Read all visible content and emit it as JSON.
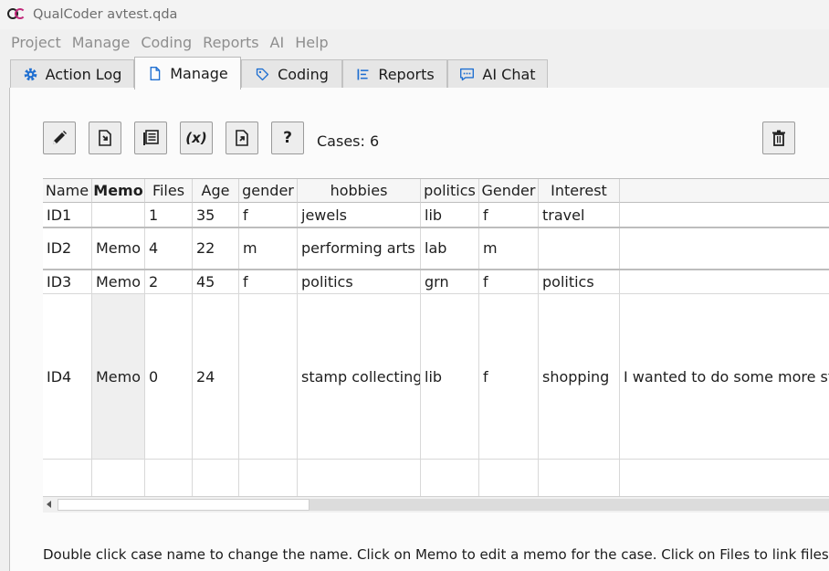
{
  "window": {
    "title": "QualCoder avtest.qda"
  },
  "menu": [
    "Project",
    "Manage",
    "Coding",
    "Reports",
    "AI",
    "Help"
  ],
  "tabs": [
    {
      "label": "Action Log",
      "icon": "gear-icon"
    },
    {
      "label": "Manage",
      "icon": "document-icon",
      "active": true
    },
    {
      "label": "Coding",
      "icon": "tag-icon"
    },
    {
      "label": "Reports",
      "icon": "list-icon"
    },
    {
      "label": "AI Chat",
      "icon": "chat-icon"
    }
  ],
  "toolbar": {
    "variables_symbol": "(x)",
    "help_symbol": "?",
    "cases_label": "Cases: 6"
  },
  "table": {
    "headers": [
      "Name",
      "Memo",
      "Files",
      "Age",
      "gender",
      "hobbies",
      "politics",
      "Gender",
      "Interest",
      ""
    ],
    "rows": [
      [
        "ID1",
        "",
        "1",
        "35",
        "f",
        "jewels",
        "lib",
        "f",
        "travel",
        ""
      ],
      [
        "ID2",
        "Memo",
        "4",
        "22",
        "m",
        "performing arts",
        "lab",
        "m",
        "",
        ""
      ],
      [
        "ID3",
        "Memo",
        "2",
        "45",
        "f",
        "politics",
        "grn",
        "f",
        "politics",
        ""
      ],
      [
        "ID4",
        "Memo",
        "0",
        "24",
        "",
        "stamp collecting",
        "lib",
        "f",
        "shopping",
        "I wanted to do some more stu"
      ],
      [
        "",
        "",
        "",
        "",
        "",
        "",
        "",
        "",
        "",
        ""
      ]
    ]
  },
  "hint": "Double click case name to change the name. Click on Memo to edit a memo for the case. Click on Files to link files"
}
